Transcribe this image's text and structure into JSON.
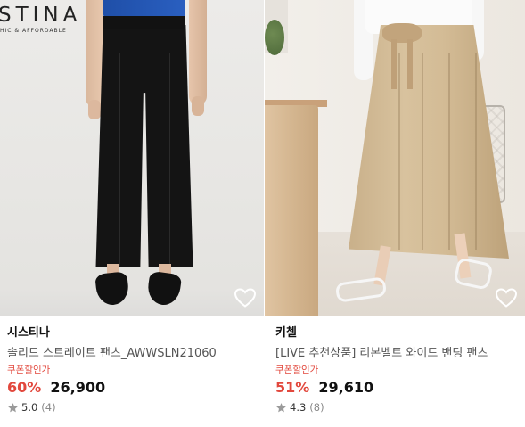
{
  "products": [
    {
      "brand": "시스티나",
      "name": "솔리드 스트레이트 팬츠_AWWSLN21060",
      "coupon_label": "쿠폰할인가",
      "discount": "60%",
      "price": "26,900",
      "rating": "5.0",
      "review_count": "(4)",
      "image_text": {
        "brand_mark": "STINA",
        "brand_sub": "HIC & AFFORDABLE"
      },
      "wishlist_icon": "heart-outline-icon"
    },
    {
      "brand": "키첼",
      "name": "[LIVE 추천상품] 리본벨트 와이드 밴딩 팬츠",
      "coupon_label": "쿠폰할인가",
      "discount": "51%",
      "price": "29,610",
      "rating": "4.3",
      "review_count": "(8)",
      "wishlist_icon": "heart-outline-icon"
    }
  ],
  "colors": {
    "accent_red": "#e2483d",
    "text_dark": "#111111",
    "text_muted": "#555555",
    "star_gray": "#9a9a9a"
  }
}
